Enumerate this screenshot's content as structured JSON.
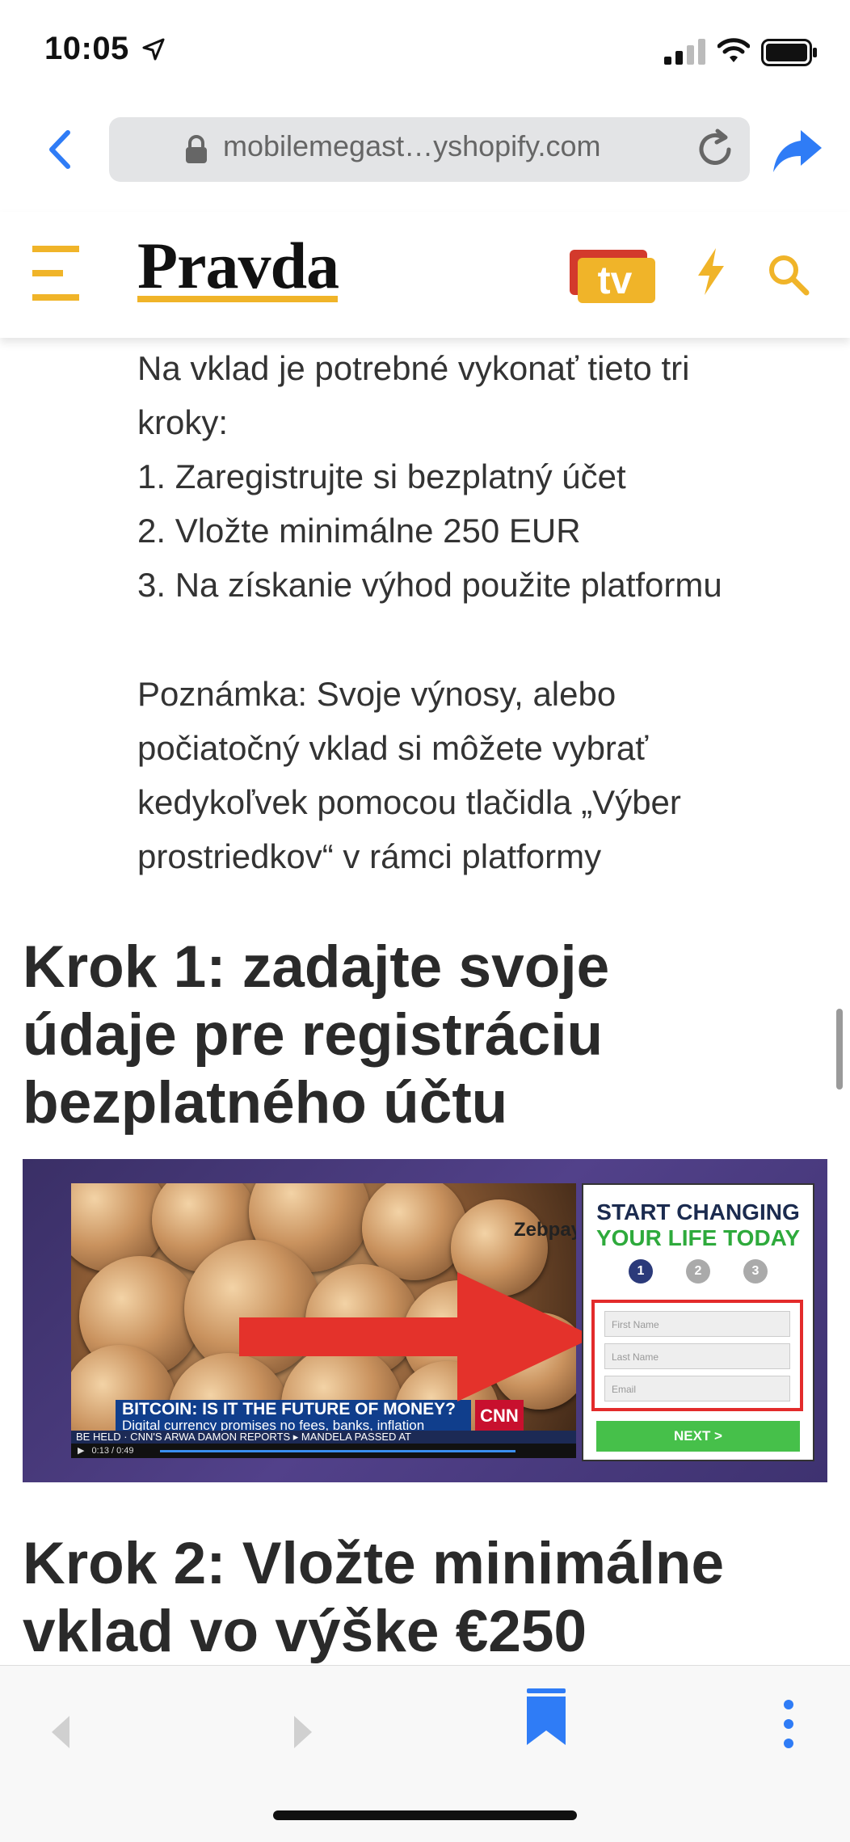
{
  "status_bar": {
    "time": "10:05"
  },
  "browser": {
    "url": "mobilemegast…yshopify.com"
  },
  "site": {
    "logo": "Pravda",
    "tv_label": "tv",
    "accent_color": "#f0b429",
    "brand_red": "#d33a2c"
  },
  "article": {
    "intro_lines": [
      "Na vklad je potrebné vykonať tieto tri",
      "kroky:",
      "1. Zaregistrujte si bezplatný účet",
      "2. Vložte minimálne 250 EUR",
      "3. Na získanie výhod použite platformu"
    ],
    "note_lines": [
      "Poznámka: Svoje výnosy, alebo",
      "počiatočný vklad si môžete vybrať",
      "kedykoľvek pomocou tlačidla „Výber",
      "prostriedkov“ v rámci platformy"
    ],
    "step1_heading_lines": [
      "Krok 1: zadajte svoje",
      "údaje pre registráciu",
      "bezplatného účtu"
    ],
    "step2_heading_lines": [
      "Krok 2: Vložte minimálne",
      "vklad vo výške €250"
    ]
  },
  "banner": {
    "brand": "Zebpay",
    "ticker_title": "BITCOIN: IS IT THE FUTURE OF MONEY?",
    "ticker_sub": "Digital currency promises no fees, banks, inflation",
    "network": "CNN",
    "crawl": "BE HELD · CNN'S ARWA DAMON REPORTS ▸ MANDELA PASSED AT",
    "player_time": "0:13 / 0:49",
    "form_title_1": "START CHANGING",
    "form_title_2": "YOUR LIFE TODAY",
    "steps": [
      "1",
      "2",
      "3"
    ],
    "field_first_name": "First Name",
    "field_last_name": "Last Name",
    "field_email": "Email",
    "next_label": "NEXT >"
  }
}
